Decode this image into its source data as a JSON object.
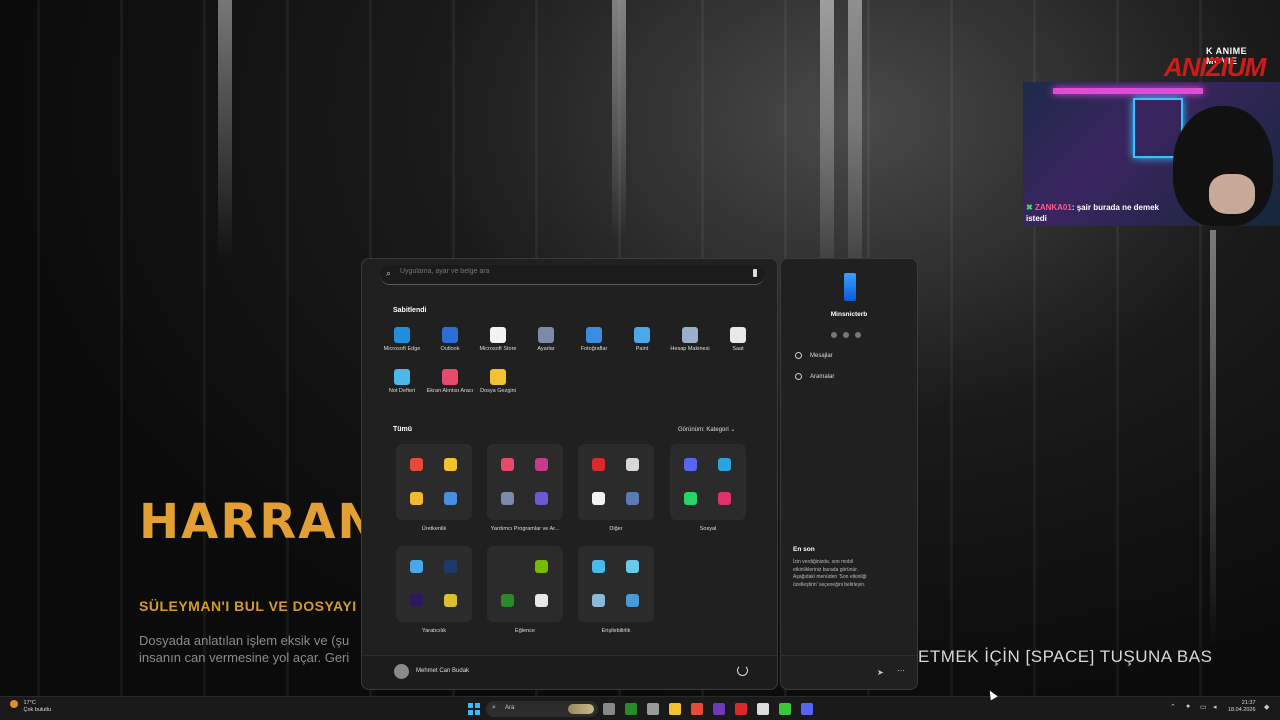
{
  "game": {
    "title": "HARRAN Ş",
    "subtitle": "SÜLEYMAN'I BUL VE DOSYAYI ELİ",
    "desc_line1": "Dosyada anlatılan işlem eksik ve (şu",
    "desc_line2": "insanın can vermesine yol açar. Geri",
    "hint": "ETMEK İÇİN [SPACE] TUŞUNA BAS"
  },
  "stream": {
    "brand_small": "K ANIME MOVIE",
    "brand_big": "ANIZIUM",
    "chat_user": "ZANKA01",
    "chat_message": ": şair burada ne demek istedi"
  },
  "start_menu": {
    "search_placeholder": "Uygulama, ayar ve belge ara",
    "pinned_title": "Sabitlendi",
    "pinned": [
      {
        "label": "Microsoft Edge",
        "icon": "edge-icon",
        "color": "#1e8fd8"
      },
      {
        "label": "Outlook",
        "icon": "outlook-icon",
        "color": "#2a6fd6"
      },
      {
        "label": "Microsoft Store",
        "icon": "store-icon",
        "color": "#f2f2f2"
      },
      {
        "label": "Ayarlar",
        "icon": "settings-icon",
        "color": "#7a8aa8"
      },
      {
        "label": "Fotoğraflar",
        "icon": "photos-icon",
        "color": "#3a8ee0"
      },
      {
        "label": "Paint",
        "icon": "paint-icon",
        "color": "#4aa8e8"
      },
      {
        "label": "Hesap Makinesi",
        "icon": "calculator-icon",
        "color": "#9ab0c8"
      },
      {
        "label": "Saat",
        "icon": "clock-icon",
        "color": "#e8e8e8"
      },
      {
        "label": "Not Defteri",
        "icon": "notepad-icon",
        "color": "#4ab8e8"
      },
      {
        "label": "Ekran Alıntısı Aracı",
        "icon": "snipping-tool-icon",
        "color": "#e84a6a"
      },
      {
        "label": "Dosya Gezgini",
        "icon": "file-explorer-icon",
        "color": "#f2c230"
      }
    ],
    "all_title": "Tümü",
    "view_label": "Görünüm: Kategori",
    "categories": [
      {
        "label": "Üretkenlik",
        "icons": [
          "chrome-icon",
          "file-explorer-icon",
          "discord-app-icon",
          "control-panel-icon"
        ],
        "colors": [
          "#e84a3a",
          "#f2c230",
          "#f2b830",
          "#4a8ee0"
        ]
      },
      {
        "label": "Yardımcı Programlar ve Ar...",
        "icons": [
          "snipping-tool-icon",
          "winrar-icon",
          "settings-icon",
          "tools-icon"
        ],
        "colors": [
          "#e84a6a",
          "#c83a8a",
          "#7a8aa8",
          "#6a5ad8"
        ]
      },
      {
        "label": "Diğer",
        "icons": [
          "opera-icon",
          "obs-icon",
          "document-icon",
          "devices-icon"
        ],
        "colors": [
          "#d82a2a",
          "#d8d8d8",
          "#f2f2f2",
          "#5a7ab8"
        ]
      },
      {
        "label": "Sosyal",
        "icons": [
          "discord-icon",
          "telegram-icon",
          "whatsapp-icon",
          "instagram-icon"
        ],
        "colors": [
          "#5865f2",
          "#2aa3e0",
          "#25d366",
          "#e1306c"
        ]
      },
      {
        "label": "Yaratıcılık",
        "icons": [
          "paint-icon",
          "photoshop-icon",
          "premiere-icon",
          "photos-icon"
        ],
        "colors": [
          "#4aa8e8",
          "#1e3a6a",
          "#2a1a5a",
          "#d8c030"
        ]
      },
      {
        "label": "Eğlence",
        "icons": [
          "epic-games-icon",
          "nvidia-icon",
          "xbox-icon",
          "media-player-icon"
        ],
        "colors": [
          "#2a2a2a",
          "#76b900",
          "#2a8a2a",
          "#e8e8e8"
        ]
      },
      {
        "label": "Erişilebilirlik",
        "icons": [
          "magnifier-icon",
          "narrator-icon",
          "keyboard-icon",
          "voice-access-icon"
        ],
        "colors": [
          "#4ab8e8",
          "#6ac8e8",
          "#8ab8d8",
          "#4a9ad8"
        ]
      }
    ],
    "user_name": "Mehmet Can Budak"
  },
  "phone_panel": {
    "device_name": "Minsnicterb",
    "messages_label": "Mesajlar",
    "calls_label": "Aramalar",
    "recent_title": "En son",
    "recent_text": "İzin verdiğinizde, son mobil etkinlikleriniz burada görünür. Aşağıdaki menüden 'Son etkinliği özelleştirin' seçeneğini belirleyin."
  },
  "taskbar": {
    "temperature": "17°C",
    "weather_text": "Çok bulutlu",
    "search_label": "Ara",
    "time": "21:37",
    "date": "18.04.2026",
    "apps": [
      {
        "icon": "task-view-icon",
        "color": "#888888"
      },
      {
        "icon": "xbox-icon",
        "color": "#2a8a2a"
      },
      {
        "icon": "settings-icon",
        "color": "#9a9a9a"
      },
      {
        "icon": "file-explorer-icon",
        "color": "#f2c230"
      },
      {
        "icon": "chrome-icon",
        "color": "#e84a3a"
      },
      {
        "icon": "obs-icon",
        "color": "#6a3ab8"
      },
      {
        "icon": "opera-icon",
        "color": "#d82a2a"
      },
      {
        "icon": "app-icon",
        "color": "#dddddd"
      },
      {
        "icon": "play-icon",
        "color": "#3ac83a"
      },
      {
        "icon": "discord-icon",
        "color": "#5865f2"
      }
    ]
  }
}
